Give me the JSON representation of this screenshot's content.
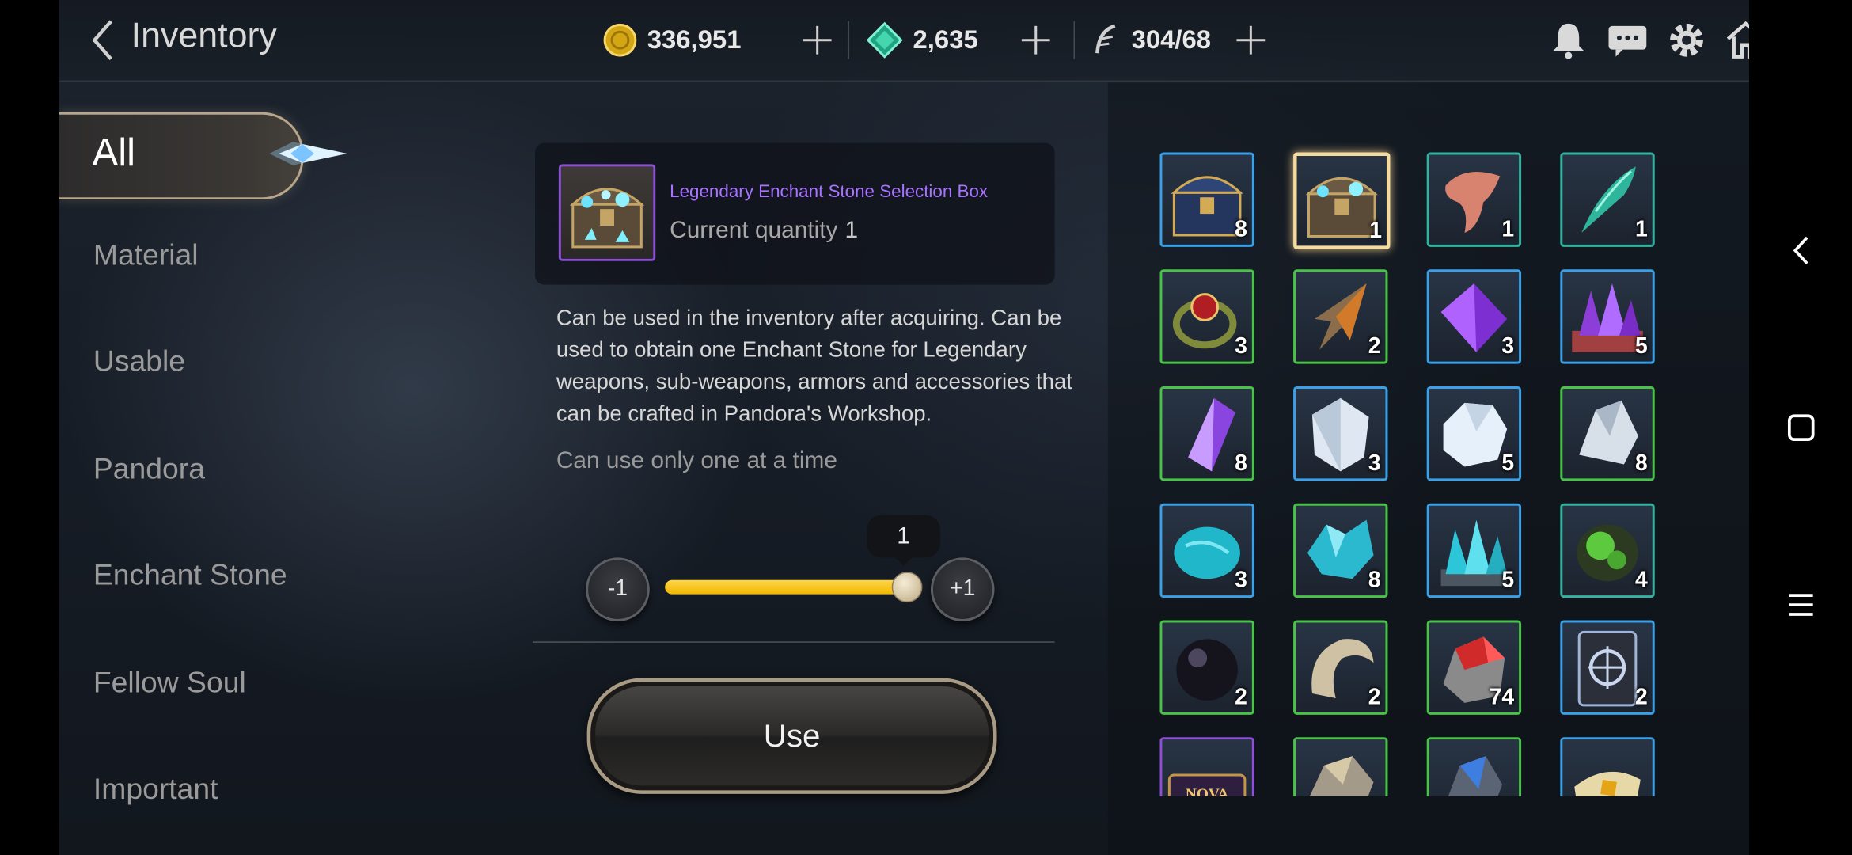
{
  "topbar": {
    "title": "Inventory",
    "gold": "336,951",
    "gems": "2,635",
    "stamina": "304/68"
  },
  "menu": {
    "items": [
      "All",
      "Material",
      "Usable",
      "Pandora",
      "Enchant Stone",
      "Fellow Soul",
      "Important"
    ]
  },
  "detail": {
    "item_name": "Legendary Enchant Stone Selection Box",
    "quantity_label": "Current quantity",
    "quantity_value": "1",
    "description": "Can be used in the inventory after acquiring. Can be used to obtain one Enchant Stone for Legendary weapons, sub-weapons, armors and accessories that can be crafted in Pandora's Workshop.",
    "note": "Can use only one at a time",
    "minus_label": "-1",
    "plus_label": "+1",
    "slider_value": "1",
    "slider_fraction": 1.0,
    "use_label": "Use"
  },
  "grid": {
    "items": [
      {
        "icon": "blue-treasure-chest-icon",
        "qty": "8",
        "frame": "blue"
      },
      {
        "icon": "enchant-stone-chest-icon",
        "qty": "1",
        "frame": "selected"
      },
      {
        "icon": "flesh-material-icon",
        "qty": "1",
        "frame": "teal"
      },
      {
        "icon": "green-blade-shard-icon",
        "qty": "1",
        "frame": "teal"
      },
      {
        "icon": "ruby-ring-icon",
        "qty": "3",
        "frame": "green"
      },
      {
        "icon": "arrowhead-icon",
        "qty": "2",
        "frame": "green"
      },
      {
        "icon": "purple-gem-icon",
        "qty": "3",
        "frame": "blue"
      },
      {
        "icon": "amethyst-cluster-icon",
        "qty": "5",
        "frame": "blue"
      },
      {
        "icon": "purple-crystal-icon",
        "qty": "8",
        "frame": "green"
      },
      {
        "icon": "white-crystal-icon",
        "qty": "3",
        "frame": "blue"
      },
      {
        "icon": "ice-ore-icon",
        "qty": "5",
        "frame": "blue"
      },
      {
        "icon": "silver-ore-icon",
        "qty": "8",
        "frame": "green"
      },
      {
        "icon": "turquoise-stone-icon",
        "qty": "3",
        "frame": "blue"
      },
      {
        "icon": "turquoise-shard-icon",
        "qty": "8",
        "frame": "green"
      },
      {
        "icon": "turquoise-crystal-cluster-icon",
        "qty": "5",
        "frame": "blue"
      },
      {
        "icon": "green-moss-stone-icon",
        "qty": "4",
        "frame": "teal"
      },
      {
        "icon": "dark-orb-icon",
        "qty": "2",
        "frame": "green"
      },
      {
        "icon": "bone-horn-icon",
        "qty": "2",
        "frame": "green"
      },
      {
        "icon": "red-ore-icon",
        "qty": "74",
        "frame": "green"
      },
      {
        "icon": "emblem-card-icon",
        "qty": "2",
        "frame": "blue"
      },
      {
        "icon": "nova-stone-icon",
        "qty": "",
        "frame": "purple",
        "text": "NOVA STONE"
      },
      {
        "icon": "gold-ore-icon",
        "qty": "",
        "frame": "green"
      },
      {
        "icon": "blue-ore-icon",
        "qty": "",
        "frame": "green"
      },
      {
        "icon": "gold-scroll-icon",
        "qty": "",
        "frame": "blue"
      }
    ]
  },
  "colors": {
    "legendary": "#a874ff",
    "slider": "#f3b700",
    "frame_blue": "#3aa0e8",
    "frame_green": "#48c247",
    "frame_teal": "#34b3a0",
    "frame_purple": "#8d4fd6",
    "selected": "#f4dba0"
  }
}
